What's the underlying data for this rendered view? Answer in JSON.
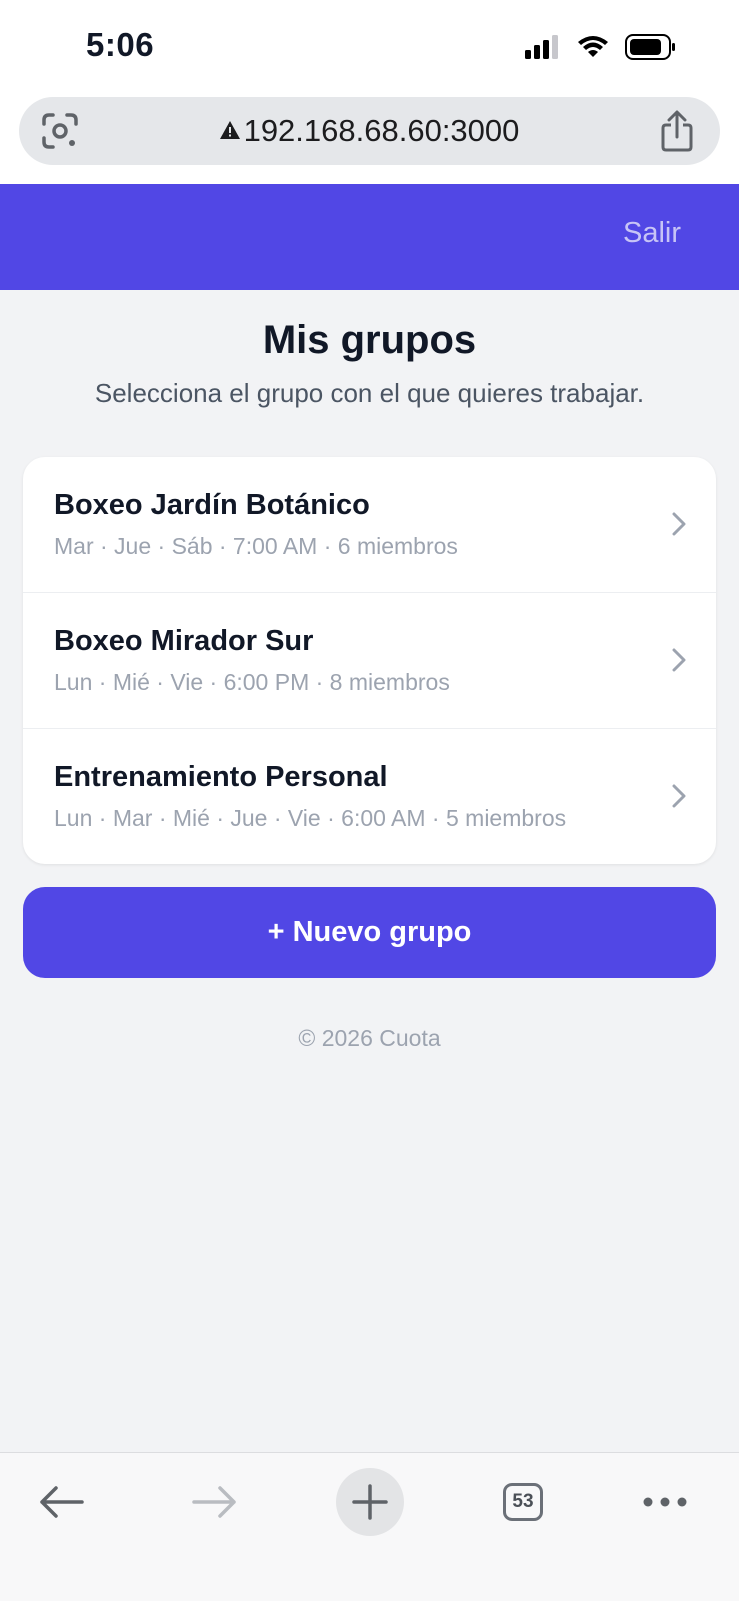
{
  "status_bar": {
    "time": "5:06"
  },
  "browser": {
    "url": "192.168.68.60:3000",
    "tab_count": "53"
  },
  "header": {
    "logout_label": "Salir"
  },
  "page": {
    "title": "Mis grupos",
    "subtitle": "Selecciona el grupo con el que quieres trabajar."
  },
  "groups": [
    {
      "name": "Boxeo Jardín Botánico",
      "details": "Mar · Jue · Sáb · 7:00 AM · 6 miembros"
    },
    {
      "name": "Boxeo Mirador Sur",
      "details": "Lun · Mié · Vie · 6:00 PM · 8 miembros"
    },
    {
      "name": "Entrenamiento Personal",
      "details": "Lun · Mar · Mié · Jue · Vie · 6:00 AM · 5 miembros"
    }
  ],
  "new_group_button": "+ Nuevo grupo",
  "footer": "© 2026 Cuota",
  "colors": {
    "brand": "#5147e5",
    "background": "#f2f3f5",
    "muted_text": "#9ca3af"
  },
  "icons": [
    "signal-icon",
    "wifi-icon",
    "battery-icon",
    "google-lens-icon",
    "warning-icon",
    "share-icon",
    "chevron-right-icon",
    "back-arrow-icon",
    "forward-arrow-icon",
    "new-tab-plus-icon",
    "tabs-icon",
    "more-icon"
  ]
}
